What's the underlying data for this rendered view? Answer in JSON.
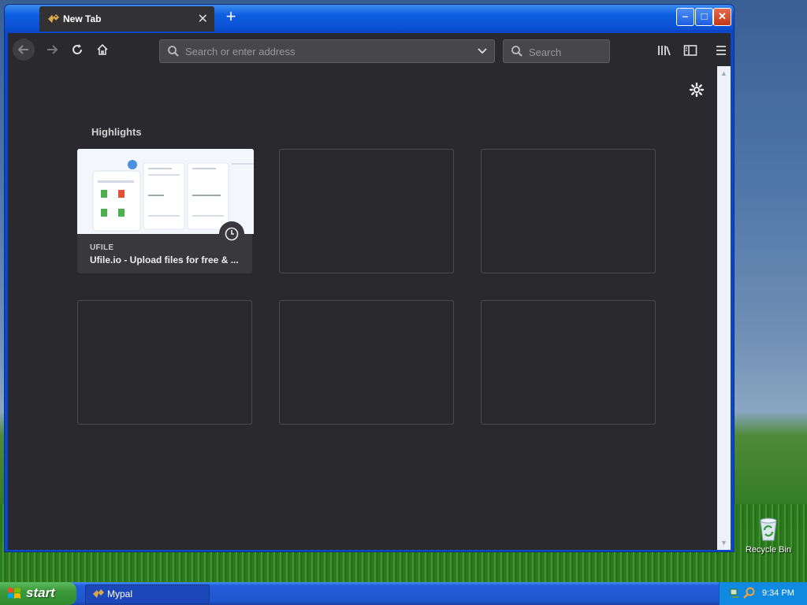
{
  "browser": {
    "tab": {
      "title": "New Tab",
      "close_glyph": "✕"
    },
    "new_tab_glyph": "+",
    "window_buttons": {
      "minimize": "–",
      "maximize": "□",
      "close": "✕"
    },
    "nav": {
      "back_icon": "back-arrow-icon",
      "forward_icon": "forward-arrow-icon",
      "reload_icon": "reload-icon",
      "home_icon": "home-icon"
    },
    "urlbar": {
      "placeholder": "Search or enter address",
      "value": ""
    },
    "searchbar": {
      "placeholder": "Search",
      "value": ""
    },
    "toolbar_icons": [
      "library-icon",
      "sidebar-icon",
      "menu-icon"
    ]
  },
  "newtab": {
    "section_title": "Highlights",
    "highlights": [
      {
        "site": "UFILE",
        "title": "Ufile.io - Upload files for free & ..."
      }
    ],
    "empty_slots": 5
  },
  "desktop": {
    "recycle_bin_label": "Recycle Bin"
  },
  "taskbar": {
    "start_label": "start",
    "items": [
      {
        "label": "Mypal"
      }
    ],
    "clock": "9:34 PM"
  },
  "colors": {
    "browser_bg": "#2a2a2e",
    "taskbar_blue": "#245edb",
    "start_green": "#3a9a3a"
  }
}
